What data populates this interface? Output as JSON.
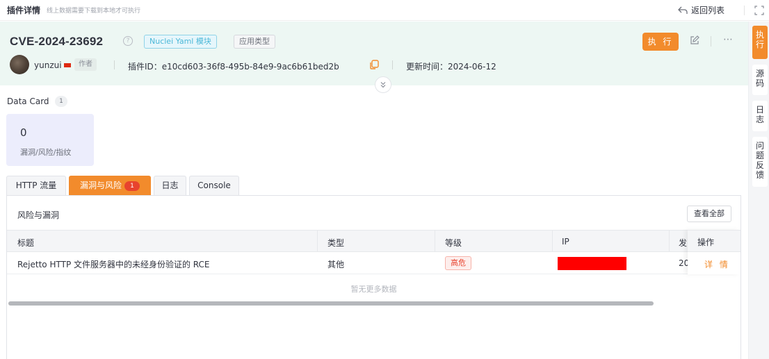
{
  "topbar": {
    "title": "插件详情",
    "subtitle": "线上数据需要下载到本地才可执行",
    "back_label": "返回列表"
  },
  "plugin": {
    "cve_id": "CVE-2024-23692",
    "tag_module": "Nuclei Yaml 模块",
    "tag_type": "应用类型",
    "execute_label": "执 行",
    "author_name": "yunzui",
    "author_tag": "作者",
    "plugin_id": "插件ID：e10cd603-36f8-495b-84e9-9ac6b61bed2b",
    "updated": "更新时间：2024-06-12"
  },
  "side_tabs": [
    {
      "label": "执行",
      "active": true
    },
    {
      "label": "源码",
      "active": false
    },
    {
      "label": "日志",
      "active": false
    },
    {
      "label": "问题反馈",
      "active": false
    }
  ],
  "data_card": {
    "title": "Data Card",
    "count": "1",
    "value": "0",
    "label": "漏洞/风险/指纹"
  },
  "tabs": [
    {
      "label": "HTTP 流量"
    },
    {
      "label": "漏洞与风险",
      "badge": "1",
      "active": true
    },
    {
      "label": "日志"
    },
    {
      "label": "Console"
    }
  ],
  "panel": {
    "title": "风险与漏洞",
    "view_all": "查看全部",
    "columns": [
      "标题",
      "类型",
      "等级",
      "IP",
      "发",
      "操作"
    ],
    "rows": [
      {
        "title": "Rejetto HTTP 文件服务器中的未经身份验证的 RCE",
        "type": "其他",
        "level": "高危",
        "time_prefix": "20",
        "action": "详 情"
      }
    ],
    "empty_text": "暂无更多数据"
  },
  "colors": {
    "accent": "#f28b2c",
    "danger": "#e8432e",
    "header_bg": "#edf7f3"
  }
}
